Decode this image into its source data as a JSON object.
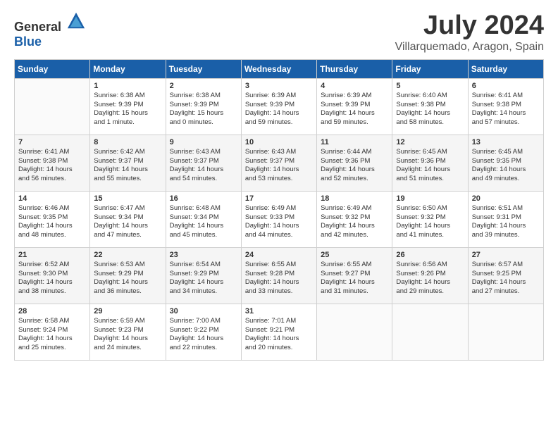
{
  "logo": {
    "general": "General",
    "blue": "Blue"
  },
  "title": {
    "month_year": "July 2024",
    "location": "Villarquemado, Aragon, Spain"
  },
  "headers": [
    "Sunday",
    "Monday",
    "Tuesday",
    "Wednesday",
    "Thursday",
    "Friday",
    "Saturday"
  ],
  "weeks": [
    [
      {
        "day": "",
        "content": ""
      },
      {
        "day": "1",
        "content": "Sunrise: 6:38 AM\nSunset: 9:39 PM\nDaylight: 15 hours\nand 1 minute."
      },
      {
        "day": "2",
        "content": "Sunrise: 6:38 AM\nSunset: 9:39 PM\nDaylight: 15 hours\nand 0 minutes."
      },
      {
        "day": "3",
        "content": "Sunrise: 6:39 AM\nSunset: 9:39 PM\nDaylight: 14 hours\nand 59 minutes."
      },
      {
        "day": "4",
        "content": "Sunrise: 6:39 AM\nSunset: 9:39 PM\nDaylight: 14 hours\nand 59 minutes."
      },
      {
        "day": "5",
        "content": "Sunrise: 6:40 AM\nSunset: 9:38 PM\nDaylight: 14 hours\nand 58 minutes."
      },
      {
        "day": "6",
        "content": "Sunrise: 6:41 AM\nSunset: 9:38 PM\nDaylight: 14 hours\nand 57 minutes."
      }
    ],
    [
      {
        "day": "7",
        "content": "Sunrise: 6:41 AM\nSunset: 9:38 PM\nDaylight: 14 hours\nand 56 minutes."
      },
      {
        "day": "8",
        "content": "Sunrise: 6:42 AM\nSunset: 9:37 PM\nDaylight: 14 hours\nand 55 minutes."
      },
      {
        "day": "9",
        "content": "Sunrise: 6:43 AM\nSunset: 9:37 PM\nDaylight: 14 hours\nand 54 minutes."
      },
      {
        "day": "10",
        "content": "Sunrise: 6:43 AM\nSunset: 9:37 PM\nDaylight: 14 hours\nand 53 minutes."
      },
      {
        "day": "11",
        "content": "Sunrise: 6:44 AM\nSunset: 9:36 PM\nDaylight: 14 hours\nand 52 minutes."
      },
      {
        "day": "12",
        "content": "Sunrise: 6:45 AM\nSunset: 9:36 PM\nDaylight: 14 hours\nand 51 minutes."
      },
      {
        "day": "13",
        "content": "Sunrise: 6:45 AM\nSunset: 9:35 PM\nDaylight: 14 hours\nand 49 minutes."
      }
    ],
    [
      {
        "day": "14",
        "content": "Sunrise: 6:46 AM\nSunset: 9:35 PM\nDaylight: 14 hours\nand 48 minutes."
      },
      {
        "day": "15",
        "content": "Sunrise: 6:47 AM\nSunset: 9:34 PM\nDaylight: 14 hours\nand 47 minutes."
      },
      {
        "day": "16",
        "content": "Sunrise: 6:48 AM\nSunset: 9:34 PM\nDaylight: 14 hours\nand 45 minutes."
      },
      {
        "day": "17",
        "content": "Sunrise: 6:49 AM\nSunset: 9:33 PM\nDaylight: 14 hours\nand 44 minutes."
      },
      {
        "day": "18",
        "content": "Sunrise: 6:49 AM\nSunset: 9:32 PM\nDaylight: 14 hours\nand 42 minutes."
      },
      {
        "day": "19",
        "content": "Sunrise: 6:50 AM\nSunset: 9:32 PM\nDaylight: 14 hours\nand 41 minutes."
      },
      {
        "day": "20",
        "content": "Sunrise: 6:51 AM\nSunset: 9:31 PM\nDaylight: 14 hours\nand 39 minutes."
      }
    ],
    [
      {
        "day": "21",
        "content": "Sunrise: 6:52 AM\nSunset: 9:30 PM\nDaylight: 14 hours\nand 38 minutes."
      },
      {
        "day": "22",
        "content": "Sunrise: 6:53 AM\nSunset: 9:29 PM\nDaylight: 14 hours\nand 36 minutes."
      },
      {
        "day": "23",
        "content": "Sunrise: 6:54 AM\nSunset: 9:29 PM\nDaylight: 14 hours\nand 34 minutes."
      },
      {
        "day": "24",
        "content": "Sunrise: 6:55 AM\nSunset: 9:28 PM\nDaylight: 14 hours\nand 33 minutes."
      },
      {
        "day": "25",
        "content": "Sunrise: 6:55 AM\nSunset: 9:27 PM\nDaylight: 14 hours\nand 31 minutes."
      },
      {
        "day": "26",
        "content": "Sunrise: 6:56 AM\nSunset: 9:26 PM\nDaylight: 14 hours\nand 29 minutes."
      },
      {
        "day": "27",
        "content": "Sunrise: 6:57 AM\nSunset: 9:25 PM\nDaylight: 14 hours\nand 27 minutes."
      }
    ],
    [
      {
        "day": "28",
        "content": "Sunrise: 6:58 AM\nSunset: 9:24 PM\nDaylight: 14 hours\nand 25 minutes."
      },
      {
        "day": "29",
        "content": "Sunrise: 6:59 AM\nSunset: 9:23 PM\nDaylight: 14 hours\nand 24 minutes."
      },
      {
        "day": "30",
        "content": "Sunrise: 7:00 AM\nSunset: 9:22 PM\nDaylight: 14 hours\nand 22 minutes."
      },
      {
        "day": "31",
        "content": "Sunrise: 7:01 AM\nSunset: 9:21 PM\nDaylight: 14 hours\nand 20 minutes."
      },
      {
        "day": "",
        "content": ""
      },
      {
        "day": "",
        "content": ""
      },
      {
        "day": "",
        "content": ""
      }
    ]
  ]
}
